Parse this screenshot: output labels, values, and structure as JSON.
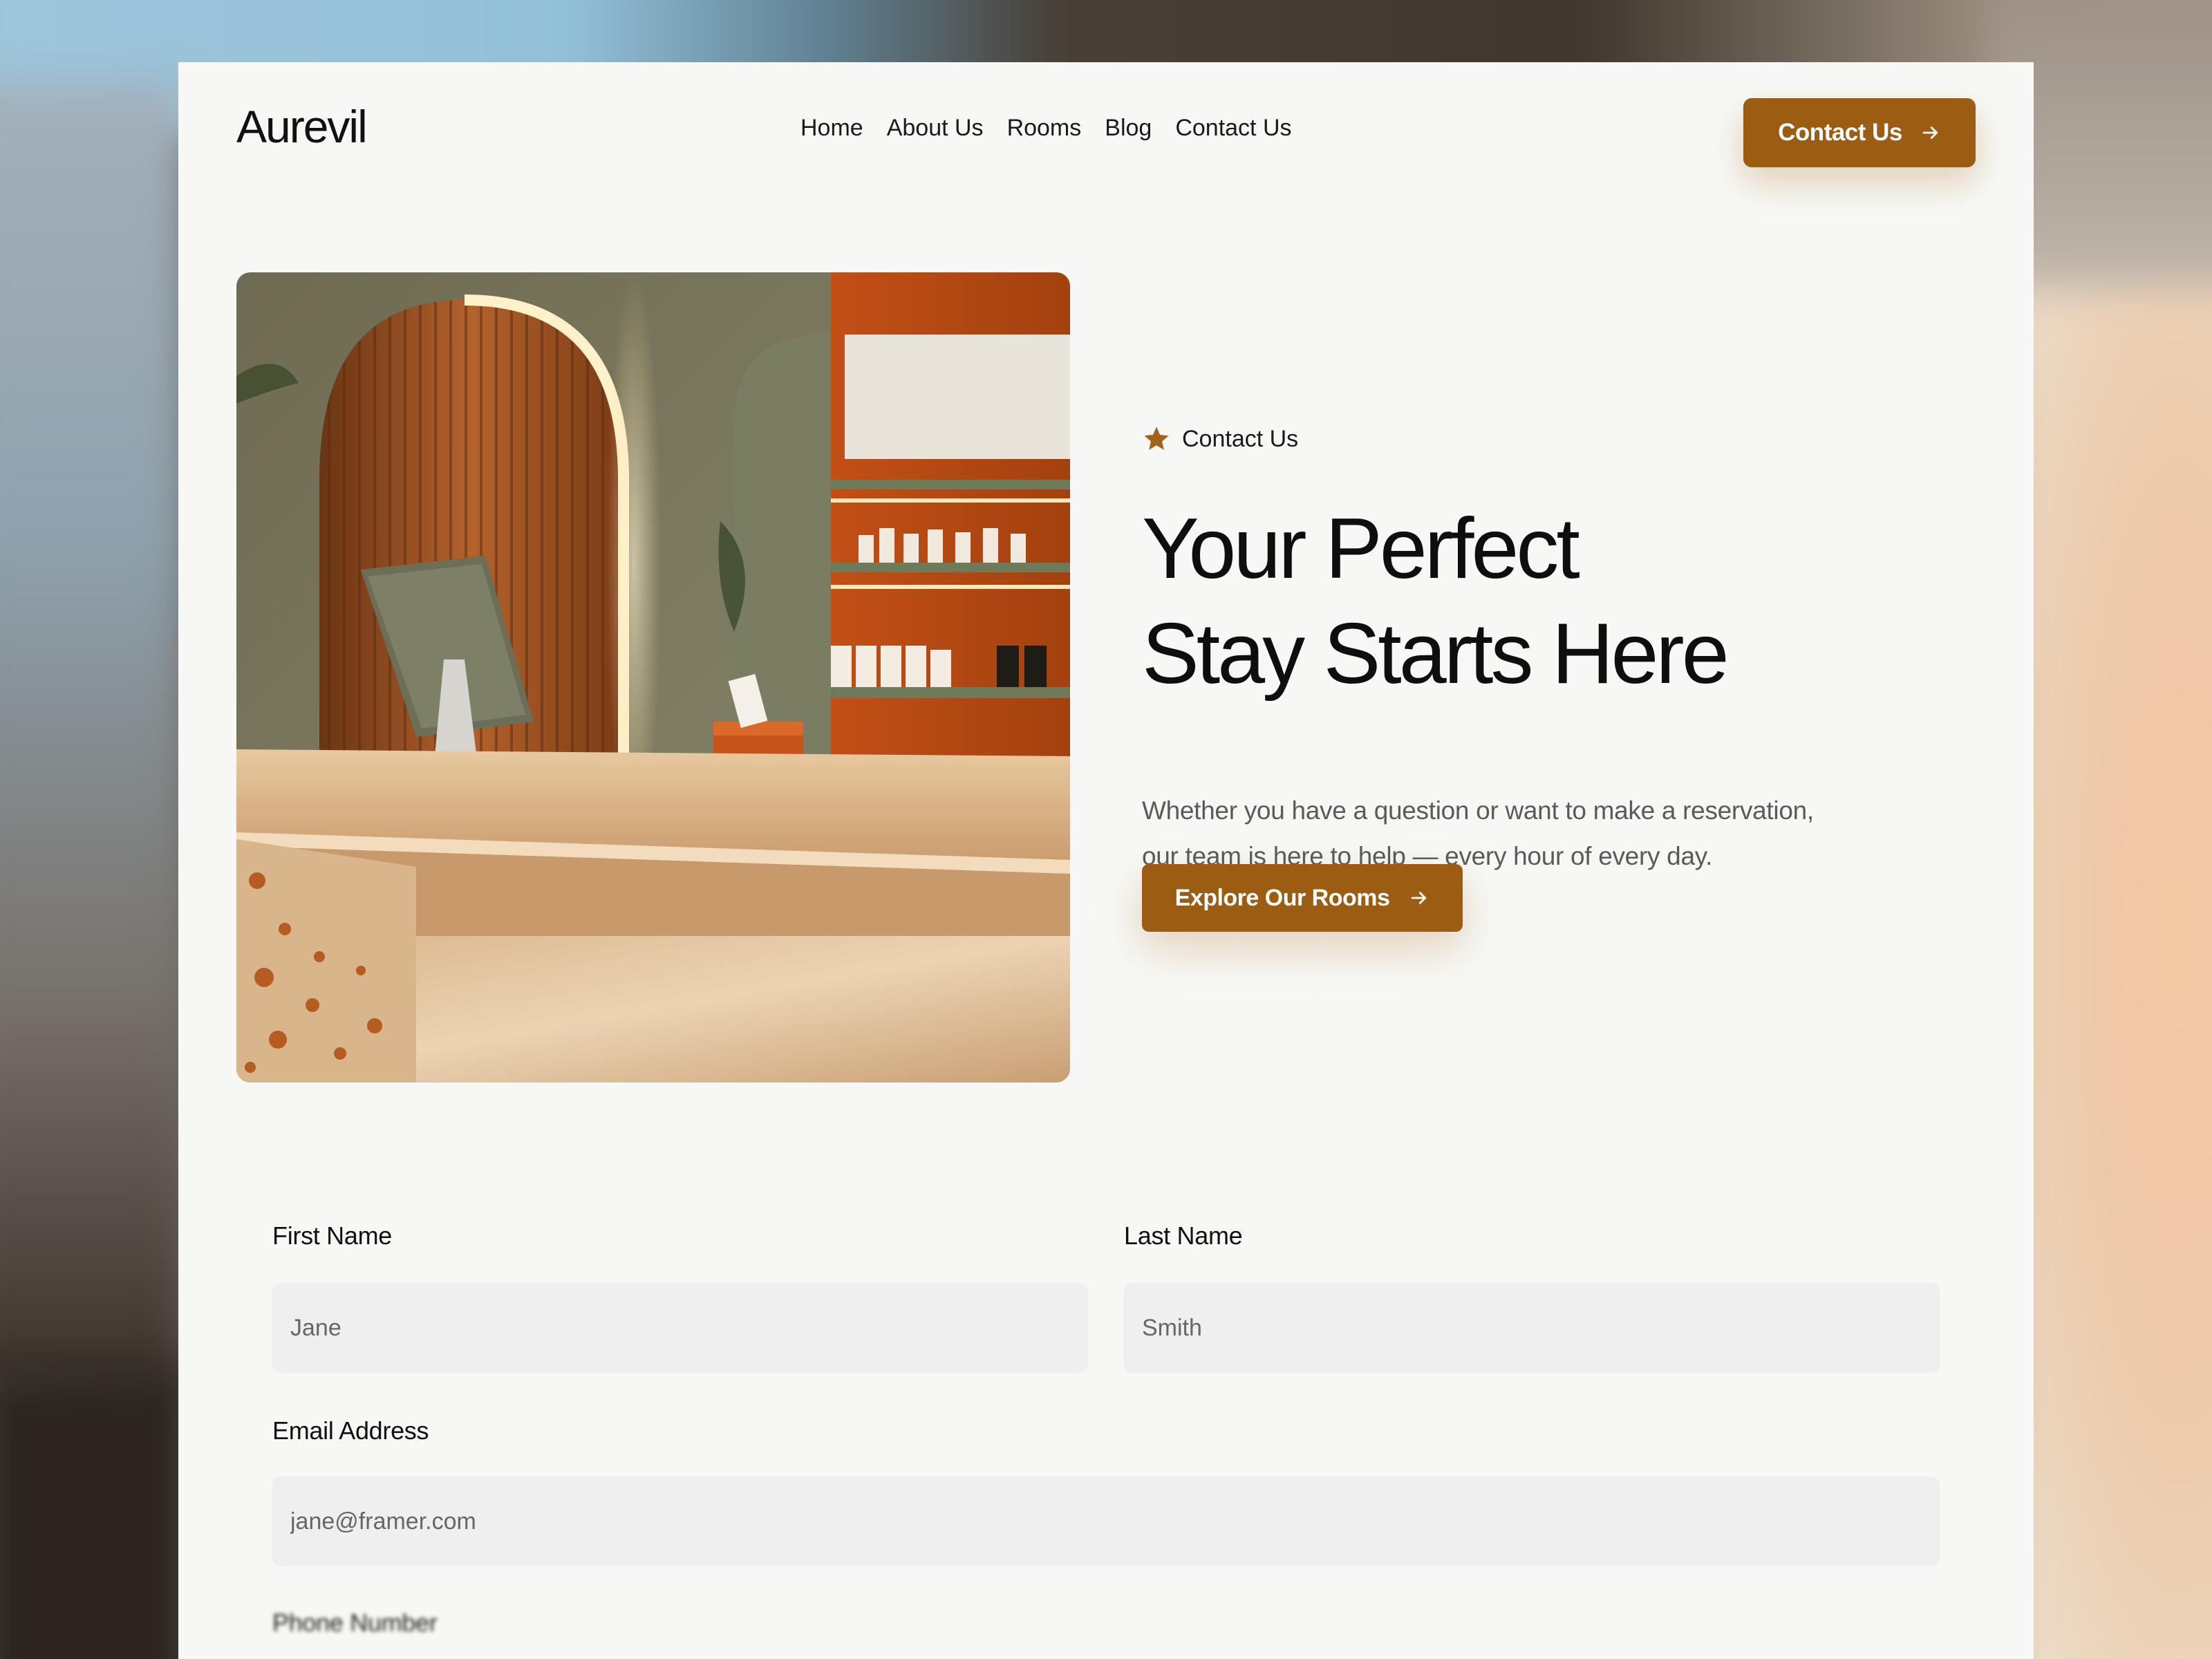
{
  "brand": {
    "logo_text": "Aurevil",
    "accent_color": "#9c5c11",
    "background_color": "#f7f8f5"
  },
  "nav": {
    "items": [
      {
        "label": "Home"
      },
      {
        "label": "About Us"
      },
      {
        "label": "Rooms"
      },
      {
        "label": "Blog"
      },
      {
        "label": "Contact Us"
      }
    ],
    "cta_label": "Contact Us",
    "cta_icon": "arrow-right-icon"
  },
  "hero": {
    "image_description": "Hotel reception desk with marble counter, arched backlit wooden panel, monitor and orange shelves",
    "eyebrow_icon": "star-icon",
    "eyebrow": "Contact Us",
    "title_line1": "Your Perfect",
    "title_line2": "Stay Starts Here",
    "description_line1": "Whether you have a question or want to make a reservation,",
    "description_line2": "our team is here to help — every hour of every day.",
    "cta_label": "Explore Our Rooms",
    "cta_icon": "arrow-right-icon"
  },
  "form": {
    "first_name": {
      "label": "First Name",
      "placeholder": "Jane"
    },
    "last_name": {
      "label": "Last Name",
      "placeholder": "Smith"
    },
    "email": {
      "label": "Email Address",
      "placeholder": "jane@framer.com"
    },
    "phone": {
      "label": "Phone Number"
    }
  }
}
